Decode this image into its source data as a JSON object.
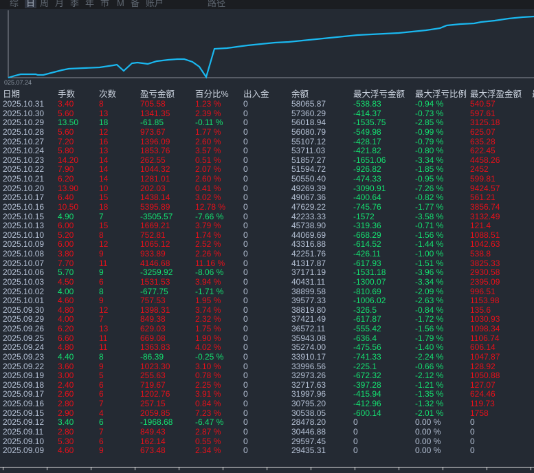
{
  "tabs": [
    "综",
    "日",
    "周",
    "月",
    "季",
    "年",
    "市",
    "M",
    "备",
    "账户",
    "路径"
  ],
  "active_tab": "日",
  "chart": {
    "start_label": "025.07.24",
    "line_color": "#1ab8f0"
  },
  "colors": {
    "profit": "#e8101a",
    "loss": "#14e070",
    "neutral": "#b4c0d4"
  },
  "columns": [
    "日期",
    "手数",
    "次数",
    "盈亏金额",
    "百分比%",
    "出入金",
    "余额",
    "最大浮亏金额",
    "最大浮亏比例",
    "最大浮盈金额",
    "最"
  ],
  "rows": [
    [
      "2025.10.31",
      "3.40",
      "8",
      "705.58",
      "1.23 %",
      "0",
      "58065.87",
      "-538.83",
      "-0.94 %",
      "540.57"
    ],
    [
      "2025.10.30",
      "5.60",
      "13",
      "1341.35",
      "2.39 %",
      "0",
      "57360.29",
      "-414.37",
      "-0.73 %",
      "597.61"
    ],
    [
      "2025.10.29",
      "13.50",
      "18",
      "-61.85",
      "-0.11 %",
      "0",
      "56018.94",
      "-1535.75",
      "-2.85 %",
      "3125.18"
    ],
    [
      "2025.10.28",
      "5.60",
      "12",
      "973.67",
      "1.77 %",
      "0",
      "56080.79",
      "-549.98",
      "-0.99 %",
      "625.07"
    ],
    [
      "2025.10.27",
      "7.20",
      "16",
      "1396.09",
      "2.60 %",
      "0",
      "55107.12",
      "-428.17",
      "-0.79 %",
      "635.28"
    ],
    [
      "2025.10.24",
      "5.80",
      "13",
      "1853.76",
      "3.57 %",
      "0",
      "53711.03",
      "-421.82",
      "-0.80 %",
      "622.45"
    ],
    [
      "2025.10.23",
      "14.20",
      "14",
      "262.55",
      "0.51 %",
      "0",
      "51857.27",
      "-1651.06",
      "-3.34 %",
      "4458.26"
    ],
    [
      "2025.10.22",
      "7.90",
      "14",
      "1044.32",
      "2.07 %",
      "0",
      "51594.72",
      "-926.82",
      "-1.85 %",
      "2452"
    ],
    [
      "2025.10.21",
      "6.20",
      "14",
      "1281.01",
      "2.60 %",
      "0",
      "50550.40",
      "-474.33",
      "-0.95 %",
      "599.81"
    ],
    [
      "2025.10.20",
      "13.90",
      "10",
      "202.03",
      "0.41 %",
      "0",
      "49269.39",
      "-3090.91",
      "-7.26 %",
      "9424.57"
    ],
    [
      "2025.10.17",
      "6.40",
      "15",
      "1438.14",
      "3.02 %",
      "0",
      "49067.36",
      "-400.64",
      "-0.82 %",
      "561.21"
    ],
    [
      "2025.10.16",
      "10.50",
      "18",
      "5395.89",
      "12.78 %",
      "0",
      "47629.22",
      "-745.76",
      "-1.77 %",
      "3856.74"
    ],
    [
      "2025.10.15",
      "4.90",
      "7",
      "-3505.57",
      "-7.66 %",
      "0",
      "42233.33",
      "-1572",
      "-3.58 %",
      "3132.49"
    ],
    [
      "2025.10.13",
      "6.00",
      "15",
      "1669.21",
      "3.79 %",
      "0",
      "45738.90",
      "-319.36",
      "-0.71 %",
      "121.4"
    ],
    [
      "2025.10.10",
      "5.20",
      "8",
      "752.81",
      "1.74 %",
      "0",
      "44069.69",
      "-668.29",
      "-1.56 %",
      "1088.51"
    ],
    [
      "2025.10.09",
      "6.00",
      "12",
      "1065.12",
      "2.52 %",
      "0",
      "43316.88",
      "-614.52",
      "-1.44 %",
      "1042.63"
    ],
    [
      "2025.10.08",
      "3.80",
      "9",
      "933.89",
      "2.26 %",
      "0",
      "42251.76",
      "-426.11",
      "-1.00 %",
      "538.8"
    ],
    [
      "2025.10.07",
      "7.70",
      "11",
      "4146.68",
      "11.16 %",
      "0",
      "41317.87",
      "-617.93",
      "-1.51 %",
      "3825.33"
    ],
    [
      "2025.10.06",
      "5.70",
      "9",
      "-3259.92",
      "-8.06 %",
      "0",
      "37171.19",
      "-1531.18",
      "-3.96 %",
      "2930.58"
    ],
    [
      "2025.10.03",
      "4.50",
      "6",
      "1531.53",
      "3.94 %",
      "0",
      "40431.11",
      "-1300.07",
      "-3.34 %",
      "2395.09"
    ],
    [
      "2025.10.02",
      "4.00",
      "8",
      "-677.75",
      "-1.71 %",
      "0",
      "38899.58",
      "-810.69",
      "-2.09 %",
      "996.51"
    ],
    [
      "2025.10.01",
      "4.60",
      "9",
      "757.53",
      "1.95 %",
      "0",
      "39577.33",
      "-1006.02",
      "-2.63 %",
      "1153.98"
    ],
    [
      "2025.09.30",
      "4.80",
      "12",
      "1398.31",
      "3.74 %",
      "0",
      "38819.80",
      "-326.5",
      "-0.84 %",
      "135.6"
    ],
    [
      "2025.09.29",
      "4.00",
      "7",
      "849.38",
      "2.32 %",
      "0",
      "37421.49",
      "-617.87",
      "-1.72 %",
      "1030.93"
    ],
    [
      "2025.09.26",
      "6.20",
      "13",
      "629.03",
      "1.75 %",
      "0",
      "36572.11",
      "-555.42",
      "-1.56 %",
      "1098.34"
    ],
    [
      "2025.09.25",
      "6.60",
      "11",
      "669.08",
      "1.90 %",
      "0",
      "35943.08",
      "-636.4",
      "-1.79 %",
      "1106.74"
    ],
    [
      "2025.09.24",
      "4.80",
      "11",
      "1363.83",
      "4.02 %",
      "0",
      "35274.00",
      "-475.56",
      "-1.40 %",
      "606.14"
    ],
    [
      "2025.09.23",
      "4.40",
      "8",
      "-86.39",
      "-0.25 %",
      "0",
      "33910.17",
      "-741.33",
      "-2.24 %",
      "1047.87"
    ],
    [
      "2025.09.22",
      "3.60",
      "9",
      "1023.30",
      "3.10 %",
      "0",
      "33996.56",
      "-225.1",
      "-0.66 %",
      "128.92"
    ],
    [
      "2025.09.19",
      "3.00",
      "5",
      "255.63",
      "0.78 %",
      "0",
      "32973.26",
      "-672.32",
      "-2.12 %",
      "1050.88"
    ],
    [
      "2025.09.18",
      "2.40",
      "6",
      "719.67",
      "2.25 %",
      "0",
      "32717.63",
      "-397.28",
      "-1.21 %",
      "127.07"
    ],
    [
      "2025.09.17",
      "2.60",
      "6",
      "1202.76",
      "3.91 %",
      "0",
      "31997.96",
      "-415.94",
      "-1.35 %",
      "624.46"
    ],
    [
      "2025.09.16",
      "2.80",
      "7",
      "257.15",
      "0.84 %",
      "0",
      "30795.20",
      "-412.96",
      "-1.32 %",
      "119.73"
    ],
    [
      "2025.09.15",
      "2.90",
      "4",
      "2059.85",
      "7.23 %",
      "0",
      "30538.05",
      "-600.14",
      "-2.01 %",
      "1758"
    ],
    [
      "2025.09.12",
      "3.40",
      "6",
      "-1968.68",
      "-6.47 %",
      "0",
      "28478.20",
      "0",
      "0.00 %",
      "0"
    ],
    [
      "2025.09.11",
      "2.80",
      "7",
      "849.43",
      "2.87 %",
      "0",
      "30446.88",
      "0",
      "0.00 %",
      "0"
    ],
    [
      "2025.09.10",
      "5.30",
      "6",
      "162.14",
      "0.55 %",
      "0",
      "29597.45",
      "0",
      "0.00 %",
      "0"
    ],
    [
      "2025.09.09",
      "4.60",
      "9",
      "673.48",
      "2.34 %",
      "0",
      "29435.31",
      "0",
      "0.00 %",
      "0"
    ]
  ]
}
